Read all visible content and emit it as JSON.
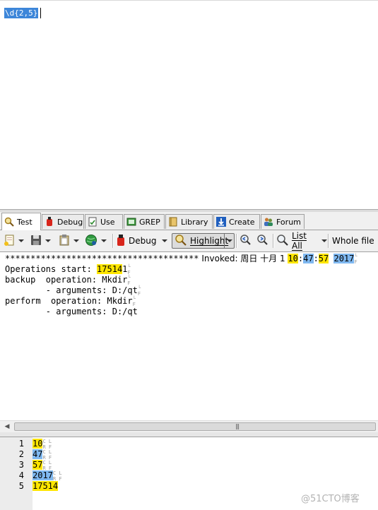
{
  "regex": {
    "pattern": "\\d{2,5}"
  },
  "tabs": [
    {
      "label": "Test",
      "icon": "magnifier-icon",
      "active": true
    },
    {
      "label": "Debug",
      "icon": "bug-icon"
    },
    {
      "label": "Use",
      "icon": "use-page-icon"
    },
    {
      "label": "GREP",
      "icon": "grep-icon"
    },
    {
      "label": "Library",
      "icon": "library-book-icon"
    },
    {
      "label": "Create",
      "icon": "create-arrow-icon"
    },
    {
      "label": "Forum",
      "icon": "forum-people-icon"
    }
  ],
  "toolbar": {
    "debug_label": "Debug",
    "highlight_label": "Highlight",
    "list_all_label": "List All",
    "whole_file_label": "Whole file"
  },
  "test_text": {
    "line1": {
      "stars": "**************************************",
      "invoked": " Invoked: 周日 十月 1 ",
      "m_hour": "10",
      "colon1": ":",
      "m_min": "47",
      "colon2": ":",
      "m_sec": "57",
      "space": " ",
      "m_year": "2017"
    },
    "line2": {
      "prefix": "Operations start: ",
      "m_a": "17514",
      "rest": "1"
    },
    "line3": {
      "text": "backup  operation: Mkdir"
    },
    "line4": {
      "text": "        - arguments: D:/qt"
    },
    "line5": {
      "text": "perform  operation: Mkdir"
    },
    "line6": {
      "text": "        - arguments: D:/qt"
    }
  },
  "results": [
    {
      "num": "1",
      "value": "10"
    },
    {
      "num": "2",
      "value": "47"
    },
    {
      "num": "3",
      "value": "57"
    },
    {
      "num": "4",
      "value": "2017"
    },
    {
      "num": "5",
      "value": "17514"
    }
  ],
  "watermark": "@51CTO博客"
}
